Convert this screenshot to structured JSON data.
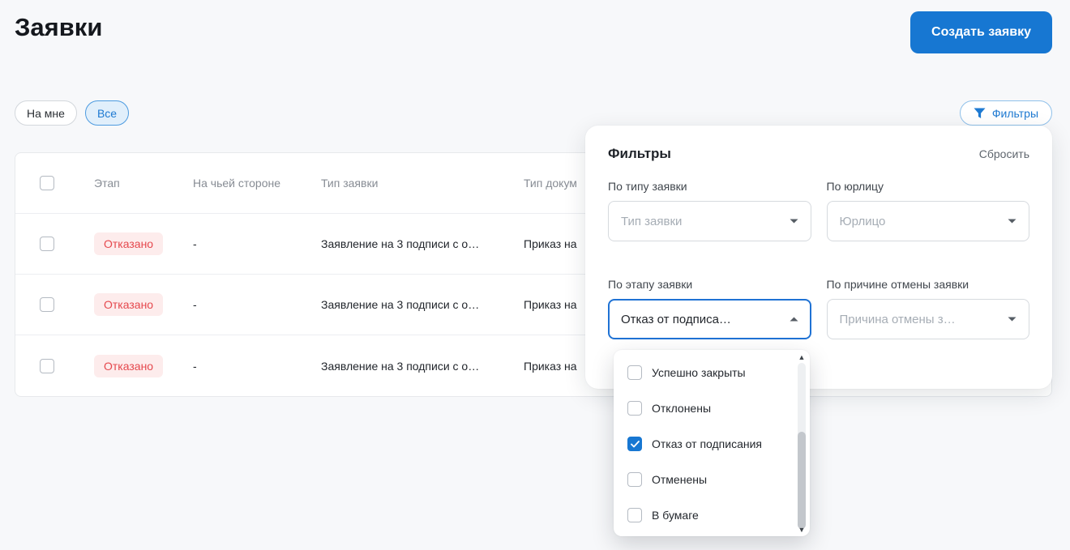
{
  "page": {
    "title": "Заявки"
  },
  "header": {
    "create_button_label": "Создать заявку"
  },
  "toolbar": {
    "chips": [
      {
        "label": "На мне",
        "active": false
      },
      {
        "label": "Все",
        "active": true
      }
    ],
    "filters_button_label": "Фильтры"
  },
  "table": {
    "columns": [
      "Этап",
      "На чьей стороне",
      "Тип заявки",
      "Тип докум"
    ],
    "rows": [
      {
        "stage": "Отказано",
        "side": "-",
        "request_type": "Заявление на 3 подписи с о…",
        "document_type": "Приказ на"
      },
      {
        "stage": "Отказано",
        "side": "-",
        "request_type": "Заявление на 3 подписи с о…",
        "document_type": "Приказ на"
      },
      {
        "stage": "Отказано",
        "side": "-",
        "request_type": "Заявление на 3 подписи с о…",
        "document_type": "Приказ на"
      }
    ]
  },
  "filter_panel": {
    "title": "Фильтры",
    "reset_label": "Сбросить",
    "fields": [
      {
        "label": "По типу заявки",
        "value": "Тип заявки",
        "is_placeholder": true,
        "open": false
      },
      {
        "label": "По юрлицу",
        "value": "Юрлицо",
        "is_placeholder": true,
        "open": false
      },
      {
        "label": "По этапу заявки",
        "value": "Отказ от подписа…",
        "is_placeholder": false,
        "open": true
      },
      {
        "label": "По причине отмены заявки",
        "value": "Причина отмены з…",
        "is_placeholder": true,
        "open": false
      }
    ],
    "stage_dropdown": {
      "options": [
        {
          "label": "Успешно закрыты",
          "checked": false
        },
        {
          "label": "Отклонены",
          "checked": false
        },
        {
          "label": "Отказ от подписания",
          "checked": true
        },
        {
          "label": "Отменены",
          "checked": false
        },
        {
          "label": "В бумаге",
          "checked": false
        }
      ]
    }
  },
  "colors": {
    "primary_blue": "#1777d2",
    "badge_red_text": "#e5484d",
    "badge_red_bg": "#fdecec"
  }
}
